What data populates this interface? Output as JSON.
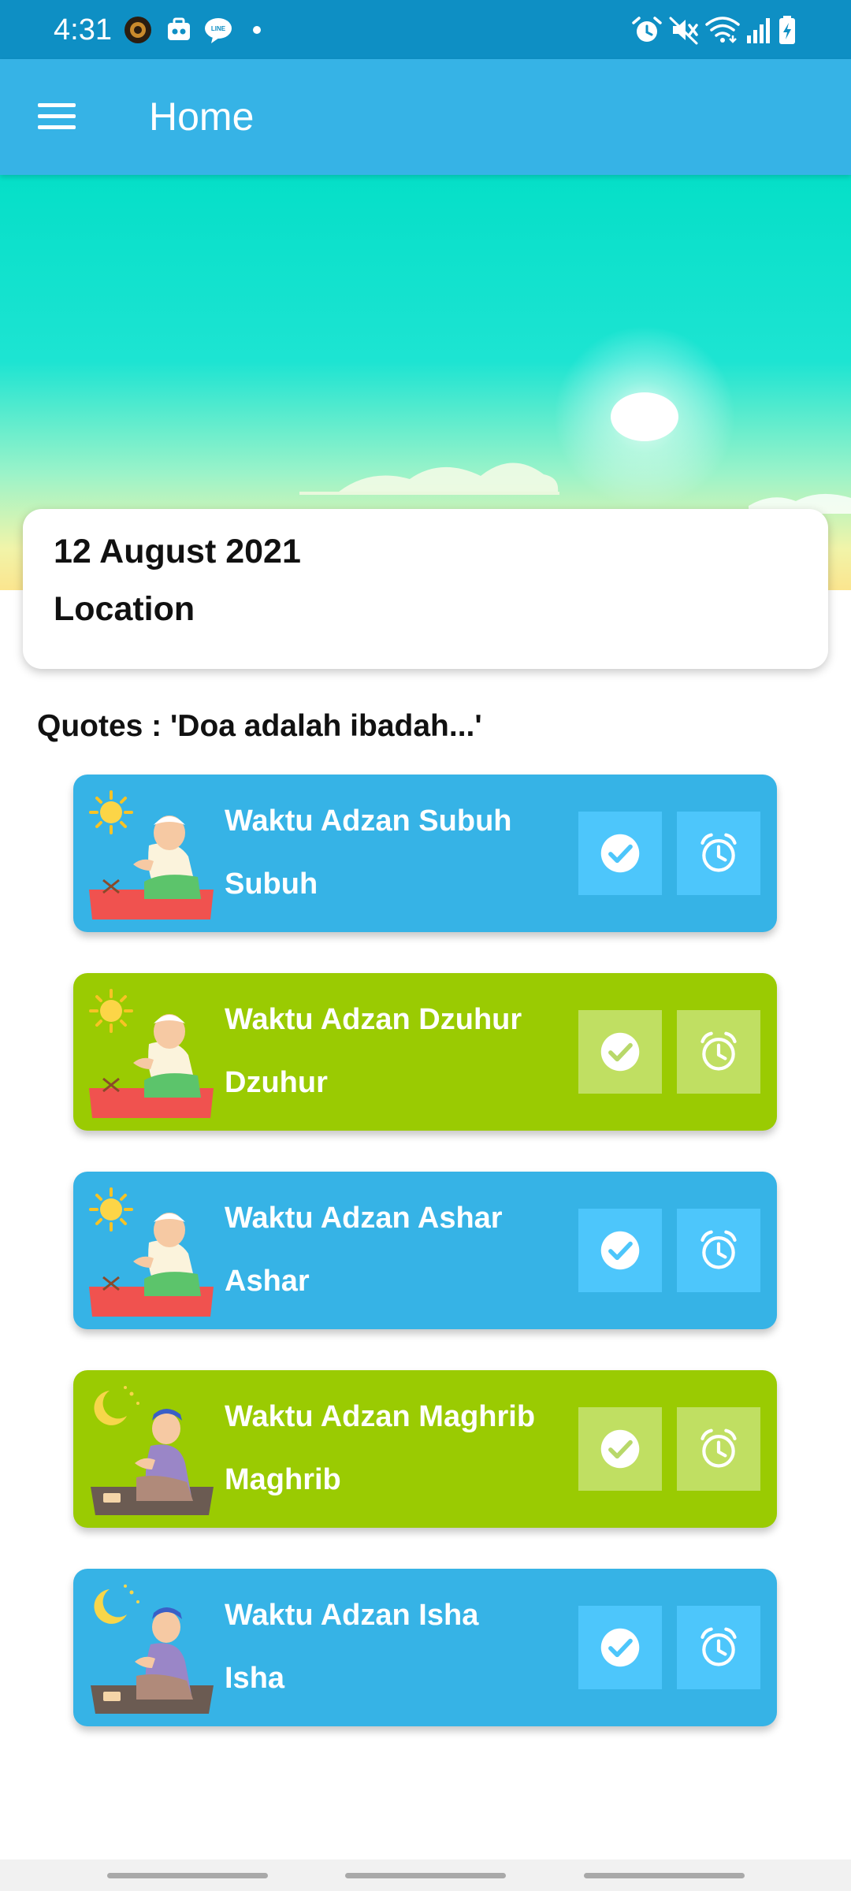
{
  "status_bar": {
    "time": "4:31",
    "notification_icons": [
      "app-logo-icon",
      "camera-bag-icon",
      "line-icon",
      "dot-icon"
    ],
    "system_icons": [
      "alarm-icon",
      "mute-icon",
      "wifi-icon",
      "signal-icon",
      "battery-charging-icon"
    ],
    "background_color": "#0e8fc4"
  },
  "app_bar": {
    "title": "Home",
    "menu_icon": "hamburger-menu-icon",
    "background_color": "#36b3e6"
  },
  "hero": {
    "scene": "sky-banner"
  },
  "date_card": {
    "date": "12 August 2021",
    "location": "Location"
  },
  "quote": {
    "text": "Quotes : 'Doa adalah ibadah...'"
  },
  "prayers": [
    {
      "title": "Waktu Adzan Subuh",
      "name": "Subuh",
      "color": "#36b3e6",
      "icon": "day-prayer-icon"
    },
    {
      "title": "Waktu Adzan Dzuhur",
      "name": "Dzuhur",
      "color": "#9acb02",
      "icon": "day-prayer-icon"
    },
    {
      "title": "Waktu Adzan Ashar",
      "name": "Ashar",
      "color": "#36b3e6",
      "icon": "day-prayer-icon"
    },
    {
      "title": "Waktu Adzan Maghrib",
      "name": "Maghrib",
      "color": "#9acb02",
      "icon": "night-prayer-icon"
    },
    {
      "title": "Waktu Adzan Isha",
      "name": "Isha",
      "color": "#36b3e6",
      "icon": "night-prayer-icon"
    }
  ],
  "card_buttons": {
    "done_icon": "check-circle-icon",
    "alarm_icon": "alarm-clock-icon"
  }
}
